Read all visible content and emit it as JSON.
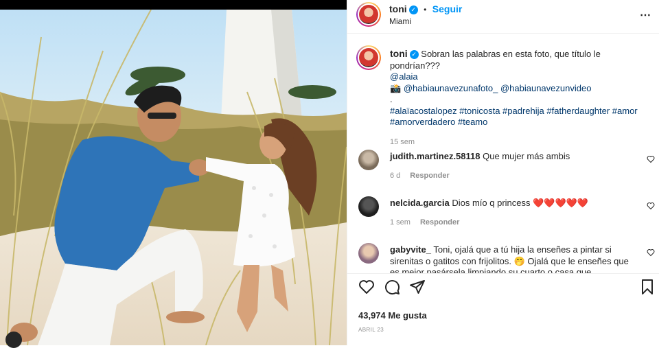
{
  "post": {
    "username": "toni",
    "follow_label": "Seguir",
    "location": "Miami",
    "more_icon": "more-options-icon",
    "caption": {
      "line1": "Sobran las palabras en esta foto, que título le pondrían???",
      "mention1": "@alaia",
      "camera_icon": "📸",
      "mention2": "@habiaunavezunafoto_",
      "mention3": "@habiaunavezunvideo",
      "dot": ".",
      "hashtags_line1": "#alaïacostalopez #tonicosta #padrehija #fatherdaughter #amor",
      "hashtags_line2": "#amorverdadero #teamo",
      "time": "15 sem"
    },
    "comments": [
      {
        "username": "judith.martinez.58118",
        "text": "Que mujer más ambis",
        "time": "6 d",
        "reply": "Responder"
      },
      {
        "username": "nelcida.garcia",
        "text": "Dios mío q princess ❤️❤️❤️❤️❤️",
        "time": "1 sem",
        "reply": "Responder"
      },
      {
        "username": "gabyvite_",
        "text": "Toni, ojalá que a tú hija la enseñes a pintar si sirenitas o gatitos con frijolitos. 🤭 Ojalá que le enseñes que es mejor pasársela limpiando su cuarto o casa que metiendo",
        "time": "",
        "reply": ""
      }
    ],
    "likes": "43,974 Me gusta",
    "date": "ABRIL 23"
  },
  "colors": {
    "accent": "#0095f6",
    "link": "#00376b",
    "text": "#262626",
    "muted": "#8e8e8e"
  }
}
